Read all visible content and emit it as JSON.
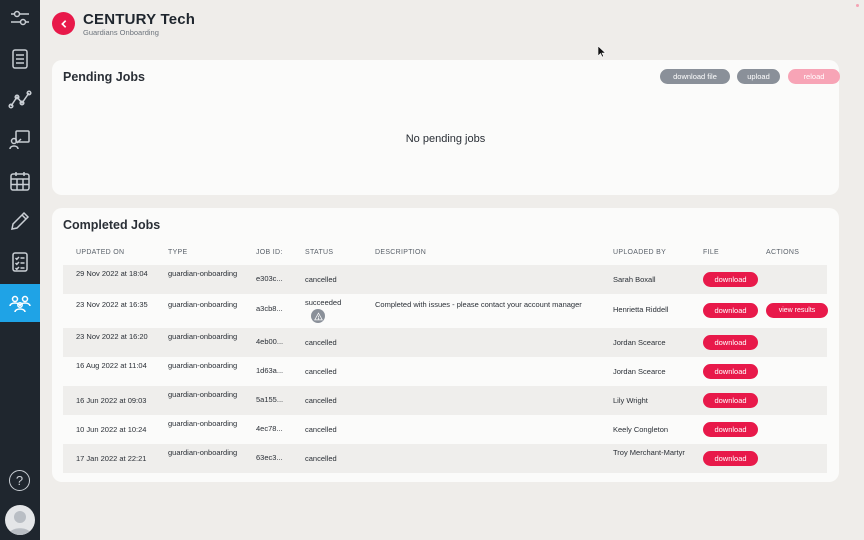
{
  "header": {
    "title": "CENTURY Tech",
    "subtitle": "Guardians Onboarding"
  },
  "sidebar": {
    "items": [
      {
        "icon": "sliders-icon"
      },
      {
        "icon": "list-icon"
      },
      {
        "icon": "graph-icon"
      },
      {
        "icon": "presentation-icon"
      },
      {
        "icon": "calendar-icon"
      },
      {
        "icon": "pencil-icon"
      },
      {
        "icon": "checklist-icon"
      },
      {
        "icon": "users-icon",
        "active": true
      }
    ],
    "help_label": "?"
  },
  "pending": {
    "title": "Pending Jobs",
    "download_file": "download file",
    "upload": "upload",
    "reload": "reload",
    "empty_message": "No pending jobs"
  },
  "completed": {
    "title": "Completed Jobs",
    "columns": {
      "updated_on": "UPDATED ON",
      "type": "TYPE",
      "job_id": "JOB ID:",
      "status": "STATUS",
      "description": "DESCRIPTION",
      "uploaded_by": "UPLOADED BY",
      "file": "FILE",
      "actions": "ACTIONS"
    },
    "download_label": "download",
    "view_results_label": "view results",
    "rows": [
      {
        "updated": "29 Nov 2022 at 18:04",
        "type": "guardian-onboarding",
        "job_id": "e303c...",
        "status": "cancelled",
        "description": "",
        "uploader": "Sarah Boxall"
      },
      {
        "updated": "23 Nov 2022 at 16:35",
        "type": "guardian-onboarding",
        "job_id": "a3cb8...",
        "status": "succeeded",
        "description": "Completed with issues - please contact your account manager",
        "uploader": "Henrietta Riddell"
      },
      {
        "updated": "23 Nov 2022 at 16:20",
        "type": "guardian-onboarding",
        "job_id": "4eb00...",
        "status": "cancelled",
        "description": "",
        "uploader": "Jordan Scearce"
      },
      {
        "updated": "16 Aug 2022 at 11:04",
        "type": "guardian-onboarding",
        "job_id": "1d63a...",
        "status": "cancelled",
        "description": "",
        "uploader": "Jordan Scearce"
      },
      {
        "updated": "16 Jun 2022 at 09:03",
        "type": "guardian-onboarding",
        "job_id": "5a155...",
        "status": "cancelled",
        "description": "",
        "uploader": "Lily Wright"
      },
      {
        "updated": "10 Jun 2022 at 10:24",
        "type": "guardian-onboarding",
        "job_id": "4ec78...",
        "status": "cancelled",
        "description": "",
        "uploader": "Keely Congleton"
      },
      {
        "updated": "17 Jan 2022 at 22:21",
        "type": "guardian-onboarding",
        "job_id": "63ec3...",
        "status": "cancelled",
        "description": "",
        "uploader": "Troy Merchant-Martyr"
      }
    ]
  },
  "colors": {
    "accent": "#e8194a",
    "sidebar": "#1f262e",
    "active_nav": "#1fa3e6",
    "grey_pill": "#8a9099"
  }
}
